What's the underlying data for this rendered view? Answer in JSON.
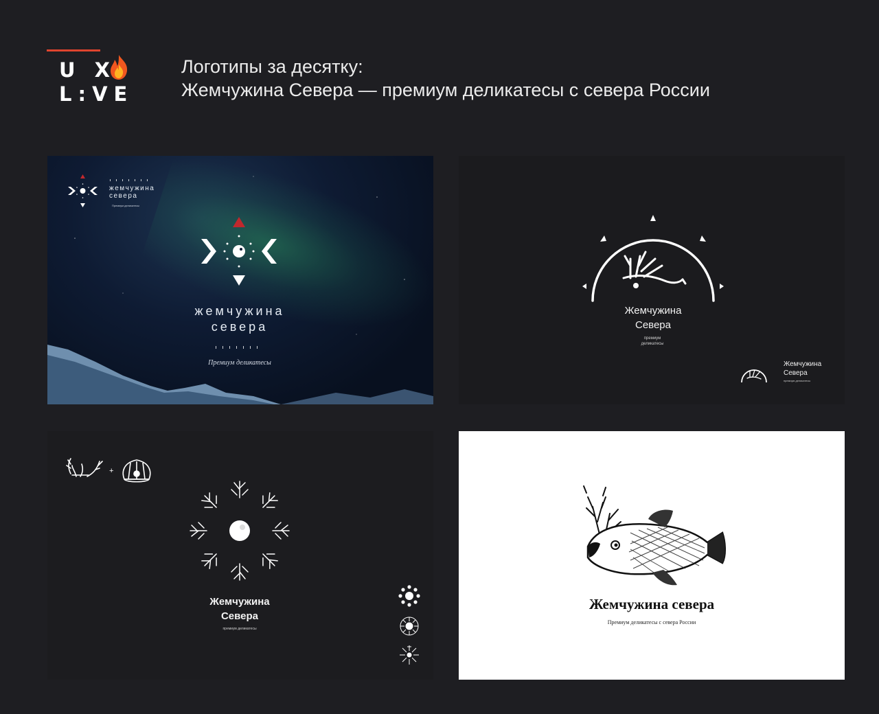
{
  "brand": {
    "line1": "U X",
    "line2": "L:VE",
    "accent": "#e0442e",
    "flame_icon": "fire-emoji"
  },
  "heading": {
    "line1": "Логотипы за десятку:",
    "line2": "Жемчужина Севера — премиум деликатесы с севера России"
  },
  "panel1": {
    "mini_name_1": "жемчужина",
    "mini_name_2": "севера",
    "mini_tag": "Премиум деликатесы",
    "name_1": "жемчужина",
    "name_2": "севера",
    "tag": "Премиум деликатесы",
    "accent": "#c0282d"
  },
  "panel2": {
    "name_1": "Жемчужина",
    "name_2": "Севера",
    "tag_1": "премиум",
    "tag_2": "деликатесы",
    "mini_name_1": "Жемчужина",
    "mini_name_2": "Севера",
    "mini_tag": "премиум деликатесы"
  },
  "panel3": {
    "plus": "+",
    "name_1": "Жемчужина",
    "name_2": "Севера",
    "tag": "премиум деликатесы"
  },
  "panel4": {
    "name": "Жемчужина севера",
    "tag": "Премиум деликатесы с севера России"
  }
}
